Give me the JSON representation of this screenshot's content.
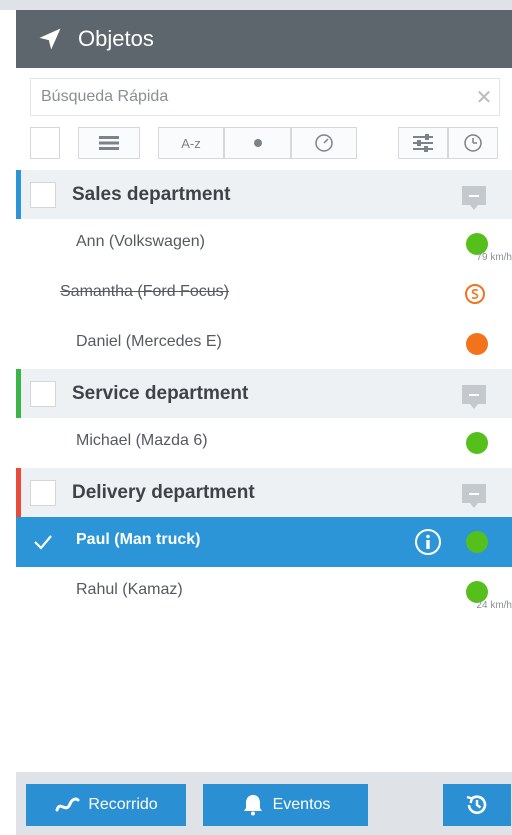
{
  "header": {
    "title": "Objetos",
    "icon": "navigation-arrow-icon"
  },
  "search": {
    "placeholder": "Búsqueda Rápida",
    "value": ""
  },
  "toolbar": {
    "sort_label": "A-z"
  },
  "colors": {
    "header_bg": "#5d656d",
    "accent": "#2b95d8",
    "online": "#55c01b",
    "offline": "#f2731c",
    "sales": "#2b95d8",
    "service": "#39b54a",
    "delivery": "#e94a3a"
  },
  "groups": [
    {
      "name": "Sales department",
      "color": "#2b95d8",
      "items": [
        {
          "label": "Ann (Volkswagen)",
          "status": "green",
          "speed": "79 km/h"
        },
        {
          "label": "Samantha (Ford Focus)",
          "status": "parking",
          "struck": true
        },
        {
          "label": "Daniel (Mercedes E)",
          "status": "orange"
        }
      ]
    },
    {
      "name": "Service department",
      "color": "#39b54a",
      "items": [
        {
          "label": "Michael (Mazda 6)",
          "status": "green"
        }
      ]
    },
    {
      "name": "Delivery department",
      "color": "#e94a3a",
      "items": [
        {
          "label": "Paul (Man truck)",
          "status": "green",
          "selected": true
        },
        {
          "label": "Rahul (Kamaz)",
          "status": "green",
          "speed": "24 km/h"
        }
      ]
    }
  ],
  "footer": {
    "route_label": "Recorrido",
    "events_label": "Eventos"
  }
}
